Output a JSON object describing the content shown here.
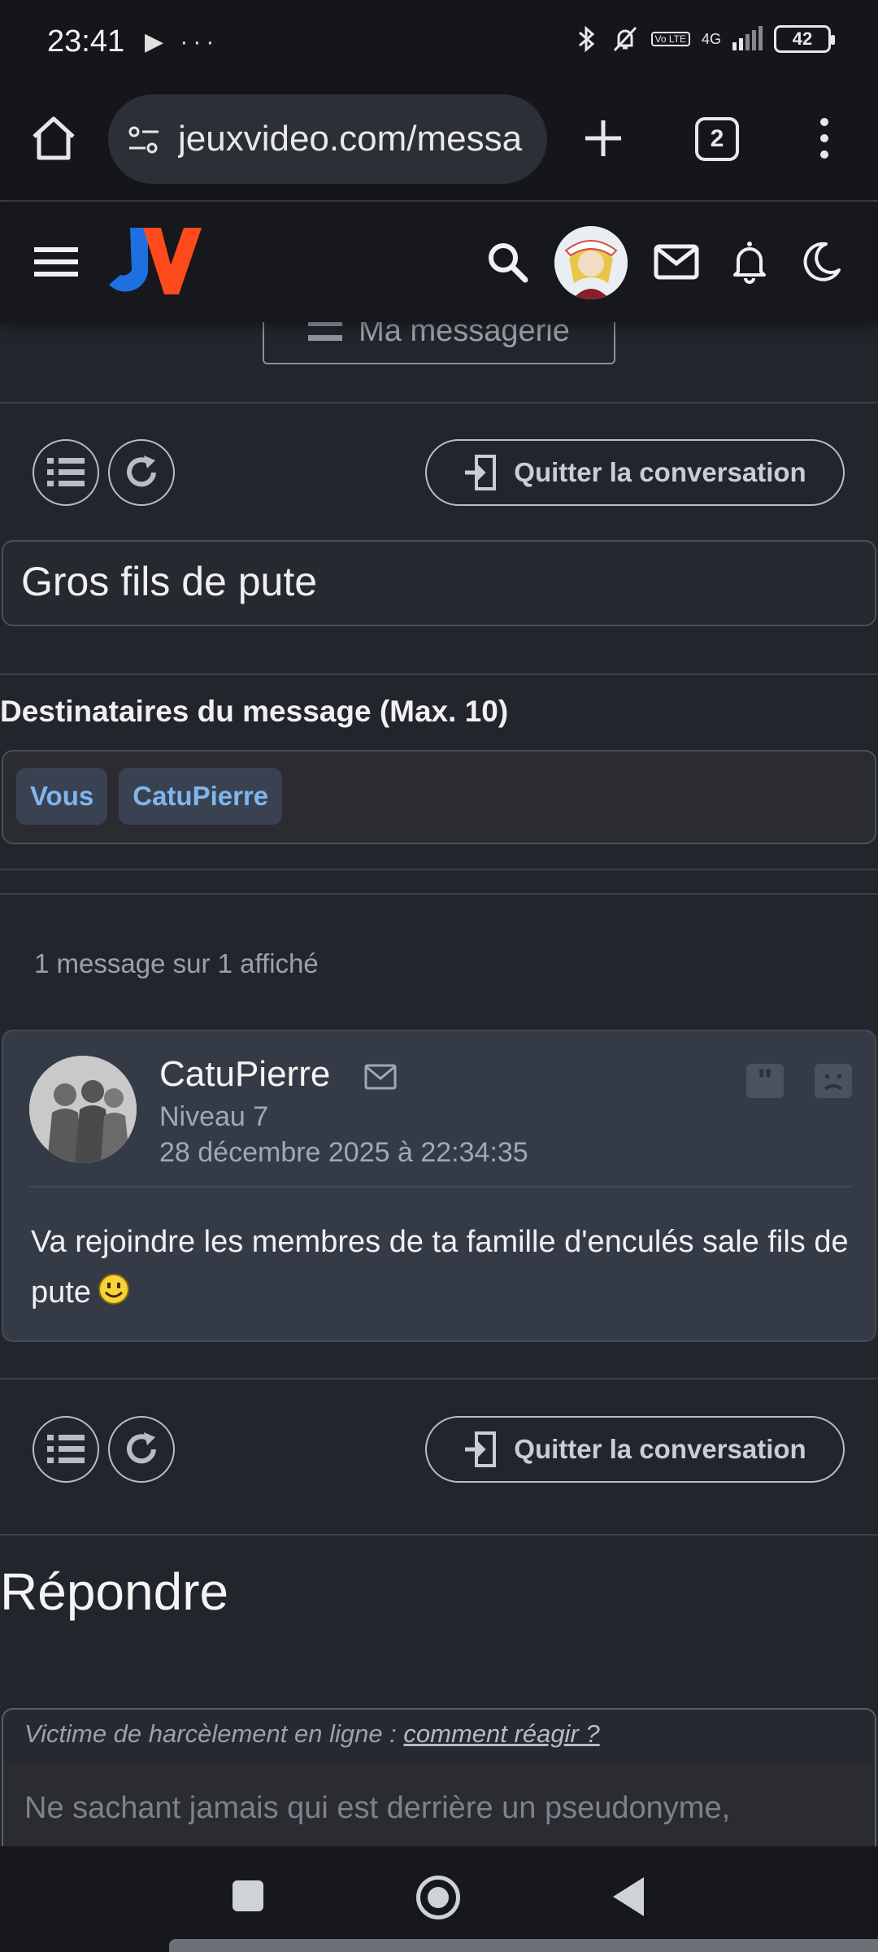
{
  "status_bar": {
    "time": "23:41",
    "left_icons": "▶ ···",
    "volte": "Vo LTE",
    "network": "4G",
    "battery": "42"
  },
  "browser": {
    "url": "jeuxvideo.com/messa",
    "tab_count": "2"
  },
  "site": {
    "logo_text": "JV",
    "colors": {
      "logo_blue": "#1e6fe0",
      "logo_red": "#ff4a1c"
    }
  },
  "page": {
    "messagerie_label": "Ma messagerie",
    "quit_label": "Quitter la conversation",
    "subject": "Gros fils de pute",
    "recipients_title": "Destinataires du message (Max. 10)",
    "recipients": [
      "Vous",
      "CatuPierre"
    ],
    "message_count": "1 message sur 1 affiché",
    "message": {
      "author": "CatuPierre",
      "level": "Niveau 7",
      "date": "28 décembre 2025 à 22:34:35",
      "body": "Va rejoindre les membres de ta famille d'enculés sale fils de pute",
      "quote_glyph": "\""
    },
    "reply_title": "Répondre",
    "reply_notice_prefix": "Victime de harcèlement en ligne : ",
    "reply_notice_link": "comment réagir ?",
    "reply_placeholder": "Ne sachant jamais qui est derrière un pseudonyme,"
  }
}
